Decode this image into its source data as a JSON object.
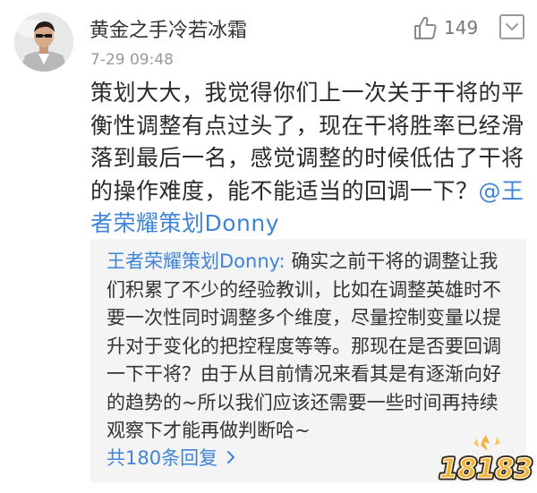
{
  "comment": {
    "username": "黄金之手冷若冰霜",
    "timestamp": "7-29 09:48",
    "like_count": "149",
    "body": "策划大大，我觉得你们上一次关于干将的平衡性调整有点过头了，现在干将胜率已经滑落到最后一名，感觉调整的时候低估了干将的操作难度，能不能适当的回调一下？",
    "mention": "@王者荣耀策划Donny"
  },
  "reply": {
    "author": "王者荣耀策划Donny",
    "separator": ": ",
    "text": "确实之前干将的调整让我们积累了不少的经验教训，比如在调整英雄时不要一次性同时调整多个维度，尽量控制变量以提升对于变化的把控程度等等。那现在是否要回调一下干将？由于从目前情况来看其是有逐渐向好的趋势的~所以我们应该还需要一些时间再持续观察下才能再做判断哈~"
  },
  "replies_link": {
    "label": "共180条回复"
  },
  "watermark": {
    "text": "18183"
  },
  "colors": {
    "link_blue": "#3f84d8",
    "reply_bg": "#f4f4f4",
    "muted_gray": "#9a9a9a"
  },
  "icons": {
    "like": "thumbs-up-icon",
    "more": "chevron-down-icon",
    "replies_arrow": "chevron-right-icon"
  }
}
